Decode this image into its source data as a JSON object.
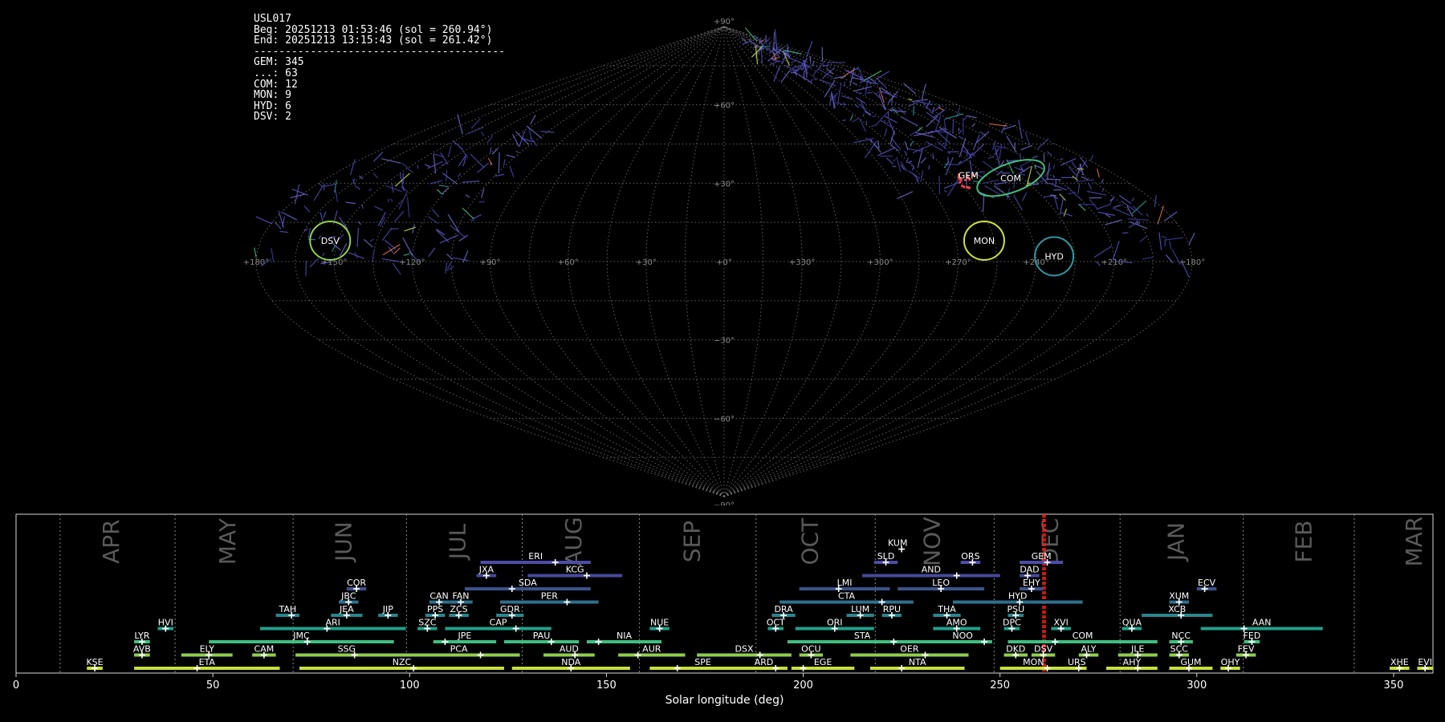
{
  "info": {
    "station": "USL017",
    "begin": "Beg: 20251213 01:53:46 (sol = 260.94°)",
    "end": "End: 20251213 13:15:43 (sol = 261.42°)",
    "divider": "----------------------------------------",
    "counts": [
      {
        "code": "GEM",
        "text": "GEM: 345"
      },
      {
        "code": "...",
        "text": "...: 63"
      },
      {
        "code": "COM",
        "text": "COM: 12"
      },
      {
        "code": "MON",
        "text": "MON: 9"
      },
      {
        "code": "HYD",
        "text": "HYD: 6"
      },
      {
        "code": "DSV",
        "text": "DSV: 2"
      }
    ]
  },
  "skymap": {
    "lat_labels": [
      "+90°",
      "+60°",
      "+30°",
      "−30°",
      "−60°",
      "−90°"
    ],
    "lon_labels": [
      "+180°",
      "+150°",
      "+120°",
      "+90°",
      "+60°",
      "+30°",
      "+0°",
      "+330°",
      "+300°",
      "+270°",
      "+240°",
      "+210°",
      "+180°"
    ],
    "radiants": [
      {
        "code": "COM",
        "lon": 130,
        "lat": 32,
        "color": "#3fbf7f"
      },
      {
        "code": "GEM",
        "lon": 112,
        "lat": 33,
        "color": "#ff4444"
      },
      {
        "code": "MON",
        "lon": 101,
        "lat": 8,
        "color": "#d0e13a"
      },
      {
        "code": "HYD",
        "lon": 127,
        "lat": 2,
        "color": "#2a9aa0"
      },
      {
        "code": "DSV",
        "lon": 207,
        "lat": 8,
        "color": "#8fd14f"
      }
    ]
  },
  "chart_data": {
    "type": "timeline",
    "xlabel": "Solar longitude (deg)",
    "xlim": [
      0,
      360
    ],
    "xticks": [
      0,
      50,
      100,
      150,
      200,
      250,
      300,
      350
    ],
    "current_sol": [
      260.94,
      261.42
    ],
    "months": [
      {
        "name": "APR",
        "center": 24.5,
        "start": 11.2
      },
      {
        "name": "MAY",
        "center": 54.0,
        "start": 40.4
      },
      {
        "name": "JUN",
        "center": 83.5,
        "start": 70.4
      },
      {
        "name": "JUL",
        "center": 112.5,
        "start": 99.2
      },
      {
        "name": "AUG",
        "center": 142.0,
        "start": 128.6
      },
      {
        "name": "SEP",
        "center": 172.0,
        "start": 158.4
      },
      {
        "name": "OCT",
        "center": 202.0,
        "start": 188.0
      },
      {
        "name": "NOV",
        "center": 233.0,
        "start": 218.3
      },
      {
        "name": "DEC",
        "center": 263.0,
        "start": 248.5
      },
      {
        "name": "JAN",
        "center": 295.0,
        "start": 280.5
      },
      {
        "name": "FEB",
        "center": 327.5,
        "start": 311.8
      },
      {
        "name": "MAR",
        "center": 355.5,
        "start": 340.0
      }
    ],
    "showers": [
      {
        "code": "KUM",
        "start": 220.5,
        "end": 227.5,
        "peak": 225,
        "row": 8
      },
      {
        "code": "ERI",
        "start": 118,
        "end": 146,
        "peak": 137,
        "row": 7
      },
      {
        "code": "SLD",
        "start": 218,
        "end": 224,
        "peak": 221,
        "row": 7
      },
      {
        "code": "ORS",
        "start": 240,
        "end": 245,
        "peak": 243,
        "row": 7
      },
      {
        "code": "GEM",
        "start": 255,
        "end": 266,
        "peak": 262,
        "row": 7
      },
      {
        "code": "JXA",
        "start": 117,
        "end": 122,
        "peak": 119.5,
        "row": 6
      },
      {
        "code": "KCG",
        "start": 130,
        "end": 154,
        "peak": 145,
        "row": 6
      },
      {
        "code": "AND",
        "start": 215,
        "end": 250,
        "peak": 239,
        "row": 6
      },
      {
        "code": "DAD",
        "start": 255,
        "end": 260,
        "peak": 257,
        "row": 6
      },
      {
        "code": "COR",
        "start": 84,
        "end": 89,
        "peak": 86.5,
        "row": 5
      },
      {
        "code": "SDA",
        "start": 114,
        "end": 146,
        "peak": 126,
        "row": 5
      },
      {
        "code": "LMI",
        "start": 199,
        "end": 222,
        "peak": 209,
        "row": 5
      },
      {
        "code": "LEO",
        "start": 224,
        "end": 246,
        "peak": 235,
        "row": 5
      },
      {
        "code": "EHY",
        "start": 255,
        "end": 261,
        "peak": 258,
        "row": 5
      },
      {
        "code": "ECV",
        "start": 300,
        "end": 305,
        "peak": 302,
        "row": 5
      },
      {
        "code": "JBC",
        "start": 82,
        "end": 87,
        "peak": 84.5,
        "row": 4
      },
      {
        "code": "CAN",
        "start": 105,
        "end": 110,
        "peak": 107.5,
        "row": 4
      },
      {
        "code": "FAN",
        "start": 110,
        "end": 116,
        "peak": 113,
        "row": 4
      },
      {
        "code": "PER",
        "start": 123,
        "end": 148,
        "peak": 140,
        "row": 4
      },
      {
        "code": "CTA",
        "start": 194,
        "end": 228,
        "peak": 220,
        "row": 4
      },
      {
        "code": "HYD",
        "start": 238,
        "end": 271,
        "peak": 255,
        "row": 4
      },
      {
        "code": "XUM",
        "start": 293,
        "end": 298,
        "peak": 295.5,
        "row": 4
      },
      {
        "code": "TAH",
        "start": 66,
        "end": 72,
        "peak": 70,
        "row": 3
      },
      {
        "code": "JEA",
        "start": 80,
        "end": 88,
        "peak": 84,
        "row": 3
      },
      {
        "code": "JIP",
        "start": 92,
        "end": 97,
        "peak": 94.5,
        "row": 3
      },
      {
        "code": "PPS",
        "start": 104,
        "end": 109,
        "peak": 106.5,
        "row": 3
      },
      {
        "code": "ZCS",
        "start": 110,
        "end": 115,
        "peak": 112.5,
        "row": 3
      },
      {
        "code": "GDR",
        "start": 122,
        "end": 129,
        "peak": 126,
        "row": 3
      },
      {
        "code": "DRA",
        "start": 192,
        "end": 198,
        "peak": 195,
        "row": 3
      },
      {
        "code": "LUM",
        "start": 211,
        "end": 218,
        "peak": 214.5,
        "row": 3
      },
      {
        "code": "RPU",
        "start": 220,
        "end": 225,
        "peak": 222.5,
        "row": 3
      },
      {
        "code": "THA",
        "start": 233,
        "end": 240,
        "peak": 236.5,
        "row": 3
      },
      {
        "code": "PSU",
        "start": 252,
        "end": 256,
        "peak": 254,
        "row": 3
      },
      {
        "code": "XCB",
        "start": 286,
        "end": 304,
        "peak": 296,
        "row": 3
      },
      {
        "code": "HVI",
        "start": 36,
        "end": 40,
        "peak": 38,
        "row": 2
      },
      {
        "code": "ARI",
        "start": 62,
        "end": 99,
        "peak": 79,
        "row": 2
      },
      {
        "code": "SZC",
        "start": 102,
        "end": 107,
        "peak": 104.5,
        "row": 2
      },
      {
        "code": "CAP",
        "start": 109,
        "end": 136,
        "peak": 127,
        "row": 2
      },
      {
        "code": "NUE",
        "start": 161,
        "end": 166,
        "peak": 163.5,
        "row": 2
      },
      {
        "code": "OCT",
        "start": 191,
        "end": 195,
        "peak": 193,
        "row": 2
      },
      {
        "code": "ORI",
        "start": 198,
        "end": 218,
        "peak": 208,
        "row": 2
      },
      {
        "code": "AMO",
        "start": 233,
        "end": 245,
        "peak": 239,
        "row": 2
      },
      {
        "code": "DPC",
        "start": 251,
        "end": 255,
        "peak": 253,
        "row": 2
      },
      {
        "code": "XVI",
        "start": 263,
        "end": 268,
        "peak": 265.5,
        "row": 2
      },
      {
        "code": "QUA",
        "start": 281,
        "end": 286,
        "peak": 283.5,
        "row": 2
      },
      {
        "code": "AAN",
        "start": 301,
        "end": 332,
        "peak": 312,
        "row": 2
      },
      {
        "code": "LYR",
        "start": 30,
        "end": 34,
        "peak": 32,
        "row": 1
      },
      {
        "code": "JMC",
        "start": 49,
        "end": 96,
        "peak": 74,
        "row": 1
      },
      {
        "code": "JPE",
        "start": 106,
        "end": 122,
        "peak": 109,
        "row": 1
      },
      {
        "code": "PAU",
        "start": 124,
        "end": 143,
        "peak": 136,
        "row": 1
      },
      {
        "code": "NIA",
        "start": 145,
        "end": 164,
        "peak": 148,
        "row": 1
      },
      {
        "code": "STA",
        "start": 196,
        "end": 234,
        "peak": 223,
        "row": 1
      },
      {
        "code": "NOO",
        "start": 233,
        "end": 248,
        "peak": 246,
        "row": 1
      },
      {
        "code": "COM",
        "start": 252,
        "end": 290,
        "peak": 264,
        "row": 1
      },
      {
        "code": "NCC",
        "start": 293,
        "end": 299,
        "peak": 296,
        "row": 1
      },
      {
        "code": "FED",
        "start": 312,
        "end": 316,
        "peak": 314,
        "row": 1
      },
      {
        "code": "AVB",
        "start": 30,
        "end": 34,
        "peak": 32,
        "row": 0
      },
      {
        "code": "ELY",
        "start": 42,
        "end": 55,
        "peak": 49,
        "row": 0
      },
      {
        "code": "CAM",
        "start": 60,
        "end": 66,
        "peak": 63,
        "row": 0
      },
      {
        "code": "SSG",
        "start": 71,
        "end": 97,
        "peak": 86,
        "row": 0
      },
      {
        "code": "PCA",
        "start": 97,
        "end": 128,
        "peak": 118,
        "row": 0
      },
      {
        "code": "AUD",
        "start": 134,
        "end": 147,
        "peak": 142,
        "row": 0
      },
      {
        "code": "AUR",
        "start": 153,
        "end": 170,
        "peak": 158,
        "row": 0
      },
      {
        "code": "DSX",
        "start": 173,
        "end": 197,
        "peak": 189,
        "row": 0
      },
      {
        "code": "OCU",
        "start": 199,
        "end": 205,
        "peak": 202,
        "row": 0
      },
      {
        "code": "OER",
        "start": 212,
        "end": 242,
        "peak": 231,
        "row": 0
      },
      {
        "code": "DKD",
        "start": 251,
        "end": 257,
        "peak": 254,
        "row": 0
      },
      {
        "code": "DSV",
        "start": 258,
        "end": 264,
        "peak": 261,
        "row": 0
      },
      {
        "code": "ALY",
        "start": 270,
        "end": 275,
        "peak": 272,
        "row": 0
      },
      {
        "code": "JLE",
        "start": 280,
        "end": 290,
        "peak": 285,
        "row": 0
      },
      {
        "code": "SCC",
        "start": 293,
        "end": 298,
        "peak": 295.5,
        "row": 0
      },
      {
        "code": "FEV",
        "start": 310,
        "end": 315,
        "peak": 312.5,
        "row": 0
      },
      {
        "code": "KSE",
        "start": 18,
        "end": 22,
        "peak": 20,
        "row": -1
      },
      {
        "code": "ETA",
        "start": 30,
        "end": 67,
        "peak": 46,
        "row": -1
      },
      {
        "code": "NZC",
        "start": 72,
        "end": 124,
        "peak": 101,
        "row": -1
      },
      {
        "code": "NDA",
        "start": 126,
        "end": 156,
        "peak": 141,
        "row": -1
      },
      {
        "code": "SPE",
        "start": 161,
        "end": 188,
        "peak": 168,
        "row": -1
      },
      {
        "code": "ARD",
        "start": 184,
        "end": 196,
        "peak": 193,
        "row": -1
      },
      {
        "code": "EGE",
        "start": 197,
        "end": 213,
        "peak": 200,
        "row": -1
      },
      {
        "code": "NTA",
        "start": 217,
        "end": 241,
        "peak": 225,
        "row": -1
      },
      {
        "code": "MON",
        "start": 250,
        "end": 267,
        "peak": 262,
        "row": -1
      },
      {
        "code": "URS",
        "start": 267,
        "end": 272,
        "peak": 270,
        "row": -1
      },
      {
        "code": "AHY",
        "start": 277,
        "end": 290,
        "peak": 285,
        "row": -1
      },
      {
        "code": "GUM",
        "start": 293,
        "end": 304,
        "peak": 298,
        "row": -1
      },
      {
        "code": "OHY",
        "start": 306,
        "end": 311,
        "peak": 308,
        "row": -1
      },
      {
        "code": "XHE",
        "start": 349,
        "end": 354,
        "peak": 351.5,
        "row": -1
      },
      {
        "code": "EVI",
        "start": 356,
        "end": 360,
        "peak": 358,
        "row": -1
      }
    ]
  }
}
